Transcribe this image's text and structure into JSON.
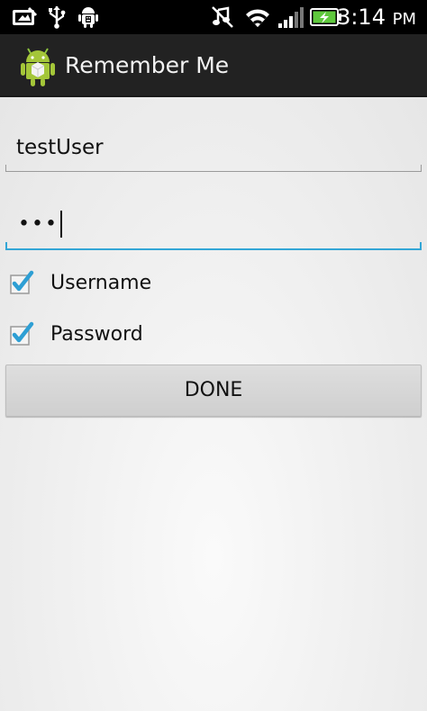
{
  "status_bar": {
    "time": "3:14",
    "time_suffix": "PM",
    "icons": [
      "notification-screenshot-icon",
      "usb-icon",
      "android-debug-icon",
      "mute-icon",
      "wifi-icon",
      "signal-icon",
      "battery-charging-icon"
    ]
  },
  "action_bar": {
    "title": "Remember Me",
    "app_icon": "android-app-icon"
  },
  "form": {
    "username_value": "testUser",
    "password_value": "•••",
    "remember_username_label": "Username",
    "remember_password_label": "Password",
    "remember_username_checked": true,
    "remember_password_checked": true,
    "done_label": "DONE"
  },
  "colors": {
    "accent": "#33a6d6",
    "check_color": "#2e9fd4",
    "action_bar_bg": "#222222",
    "status_bar_bg": "#000000"
  }
}
